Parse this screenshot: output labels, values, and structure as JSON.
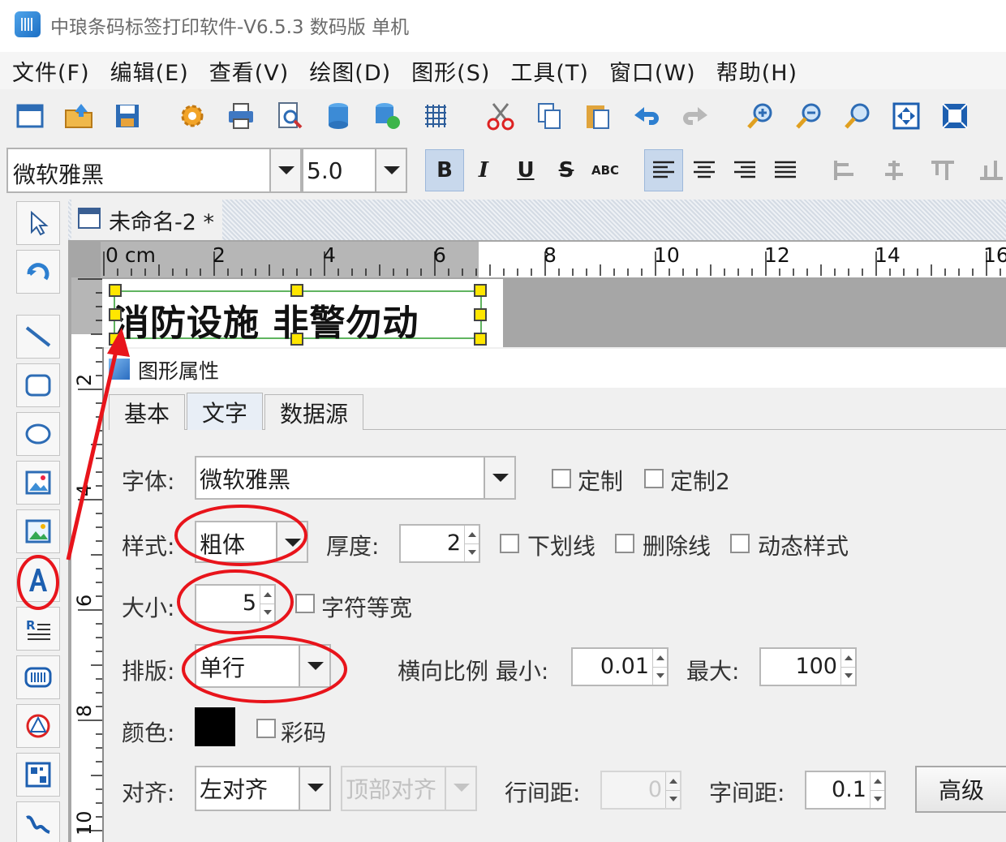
{
  "window": {
    "title": "中琅条码标签打印软件-V6.5.3 数码版 单机"
  },
  "menu": [
    "文件(F)",
    "编辑(E)",
    "查看(V)",
    "绘图(D)",
    "图形(S)",
    "工具(T)",
    "窗口(W)",
    "帮助(H)"
  ],
  "toolbar": {
    "icons": [
      "new-icon",
      "open-icon",
      "save-icon",
      "settings-icon",
      "print-icon",
      "print-preview-icon",
      "database-icon",
      "database-connect-icon",
      "grid-icon",
      "cut-icon",
      "copy-icon",
      "paste-icon",
      "undo-icon",
      "redo-icon",
      "zoom-in-icon",
      "zoom-out-icon",
      "zoom-icon",
      "fit-window-icon",
      "actual-size-icon"
    ]
  },
  "format": {
    "font": "微软雅黑",
    "size": "5.0",
    "buttons": [
      "B",
      "I",
      "U",
      "S",
      "ABC"
    ]
  },
  "document": {
    "tab_title": "未命名-2 *",
    "label_text": "消防设施  非警勿动",
    "ruler_h": [
      "0 cm",
      "2",
      "4",
      "6",
      "8",
      "10",
      "12",
      "14",
      "16"
    ],
    "ruler_v": [
      "2",
      "4",
      "6",
      "8",
      "10"
    ]
  },
  "dialog": {
    "title": "图形属性",
    "tabs": [
      "基本",
      "文字",
      "数据源"
    ],
    "active_tab": "文字",
    "font_label": "字体:",
    "font_value": "微软雅黑",
    "custom1_label": "定制",
    "custom2_label": "定制2",
    "style_label": "样式:",
    "style_value": "粗体",
    "thickness_label": "厚度:",
    "thickness_value": "2",
    "underline_label": "下划线",
    "strikethrough_label": "删除线",
    "dynamic_style_label": "动态样式",
    "size_label": "大小:",
    "size_value": "5",
    "monospace_label": "字符等宽",
    "layout_label": "排版:",
    "layout_value": "单行",
    "hscale_label": "横向比例 最小:",
    "hscale_min": "0.01",
    "max_label": "最大:",
    "hscale_max": "100",
    "color_label": "颜色:",
    "color_value": "#000000",
    "color_code_label": "彩码",
    "align_label": "对齐:",
    "align_value": "左对齐",
    "valign_value": "顶部对齐",
    "line_spacing_label": "行间距:",
    "line_spacing_value": "0",
    "char_spacing_label": "字间距:",
    "char_spacing_value": "0.1",
    "advanced_button": "高级"
  },
  "colors": {
    "annotation_red": "#e8141b",
    "selection_handle": "#ffe600",
    "selection_border": "#5fb45f"
  }
}
